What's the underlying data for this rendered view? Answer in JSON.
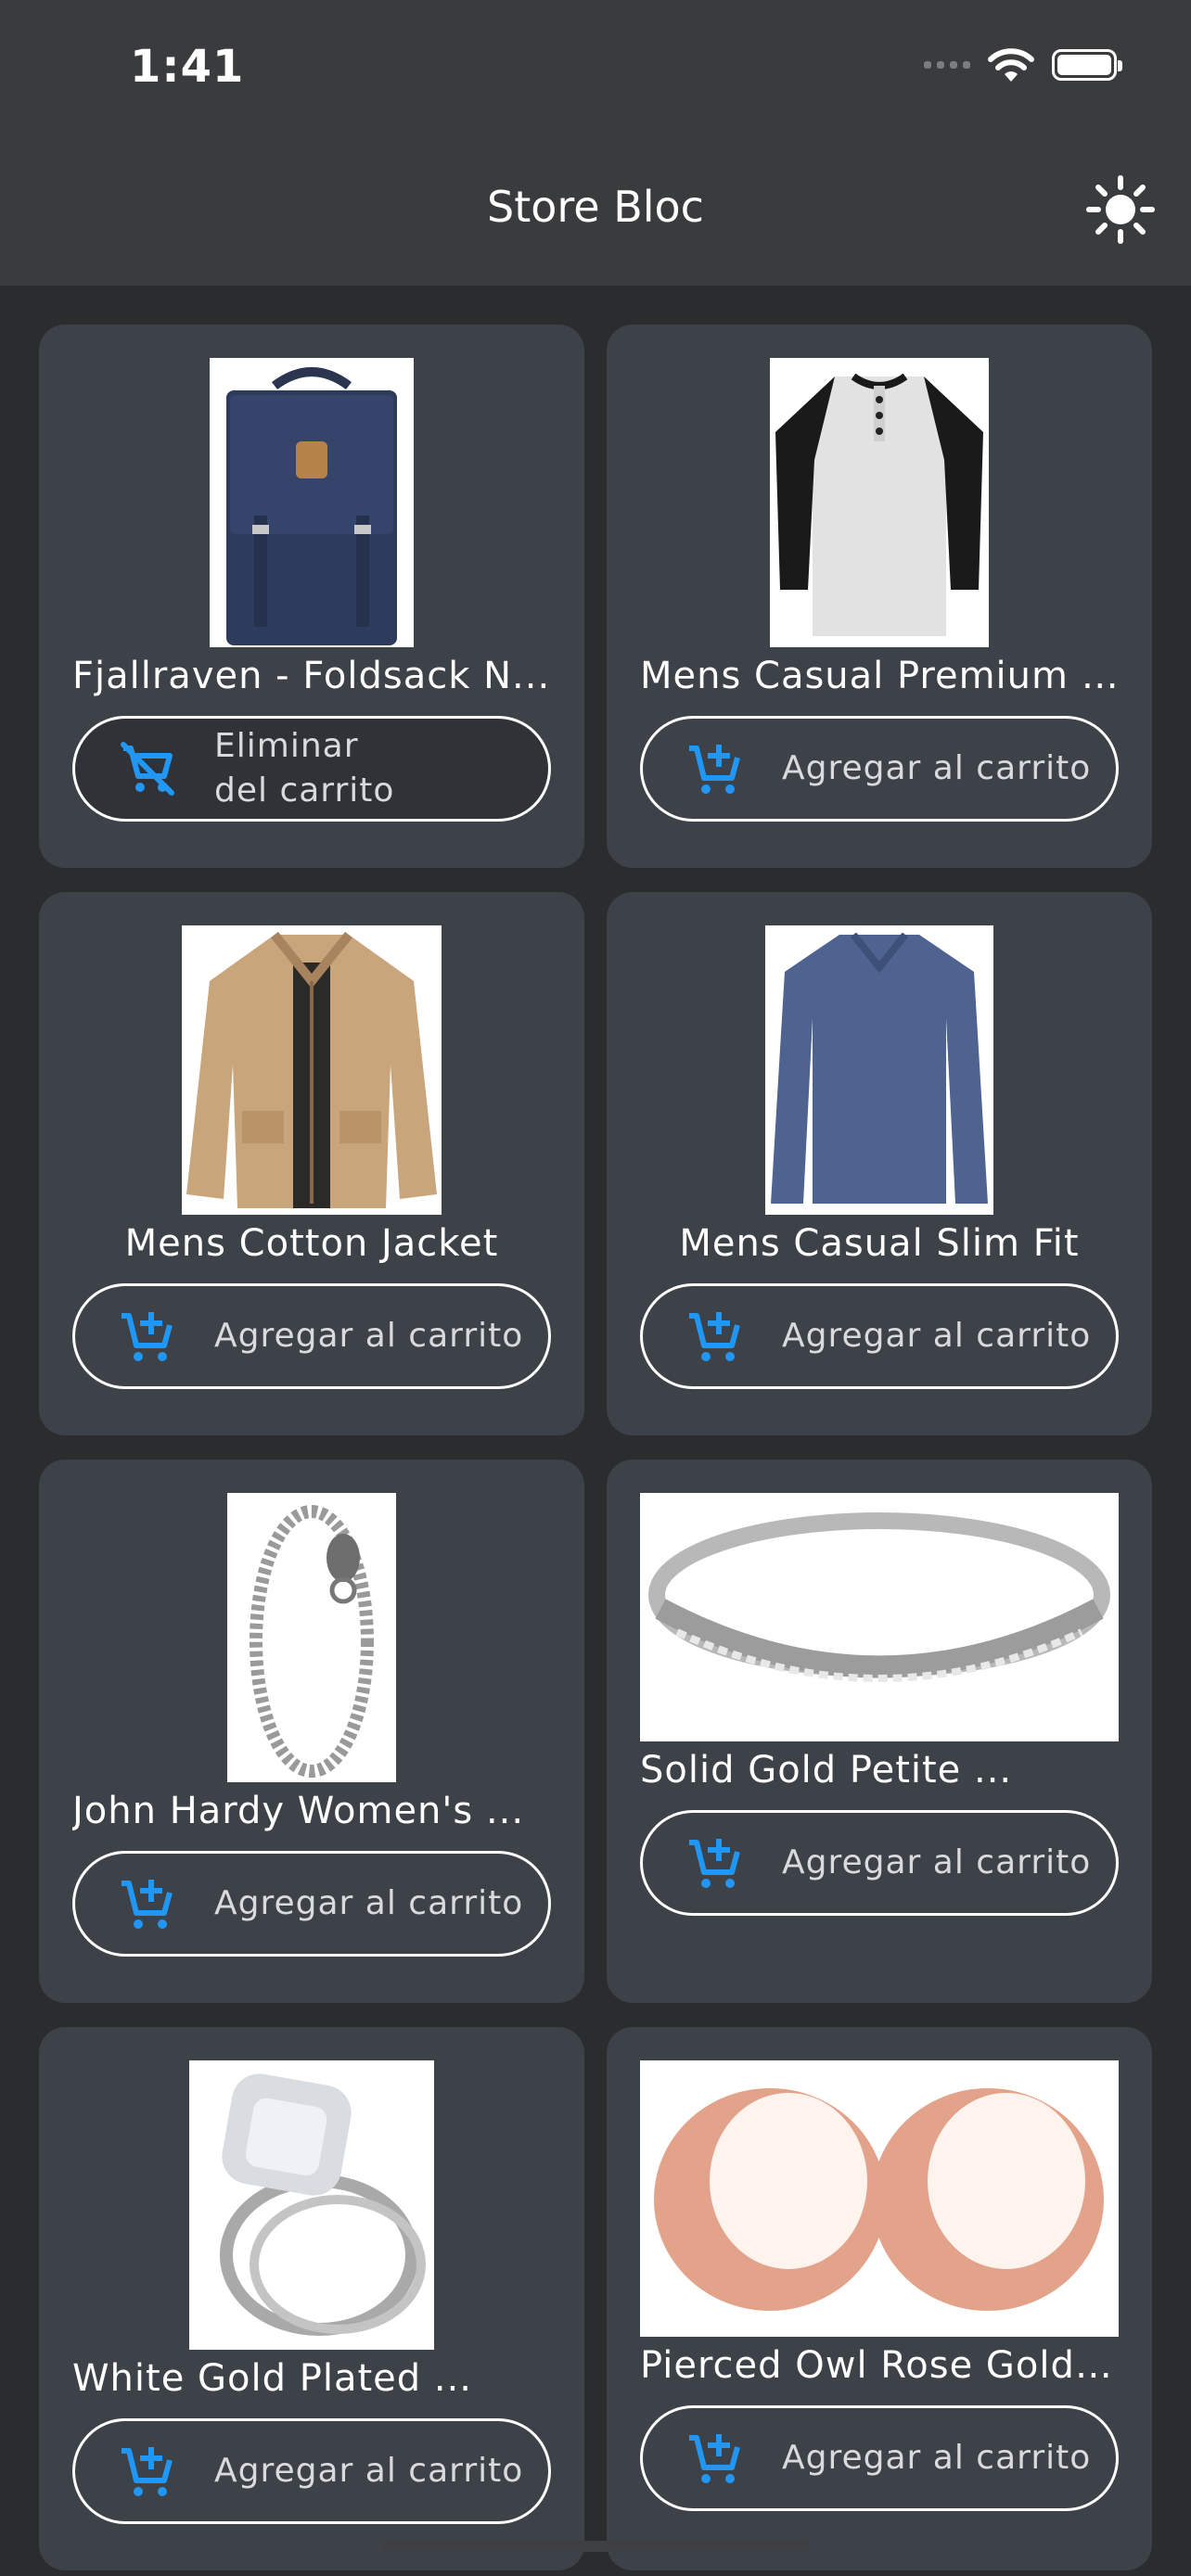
{
  "status_bar": {
    "time": "1:41"
  },
  "app_bar": {
    "title": "Store Bloc",
    "theme_icon": "sun-icon"
  },
  "colors": {
    "accent": "#2196f3",
    "card": "#3d4148",
    "appbar": "#3a3b3d",
    "background": "#2b2c2e"
  },
  "products": [
    {
      "title": "Fjallraven - Foldsack N...",
      "button": "Eliminar del carrito",
      "icon": "remove-shopping-cart-icon",
      "in_cart": true
    },
    {
      "title": "Mens Casual Premium ...",
      "button": "Agregar al carrito",
      "icon": "add-shopping-cart-icon",
      "in_cart": false
    },
    {
      "title": "Mens Cotton Jacket",
      "button": "Agregar al carrito",
      "icon": "add-shopping-cart-icon",
      "in_cart": false
    },
    {
      "title": "Mens Casual Slim Fit",
      "button": "Agregar al carrito",
      "icon": "add-shopping-cart-icon",
      "in_cart": false
    },
    {
      "title": "John Hardy Women's ...",
      "button": "Agregar al carrito",
      "icon": "add-shopping-cart-icon",
      "in_cart": false
    },
    {
      "title": "Solid Gold Petite ...",
      "button": "Agregar al carrito",
      "icon": "add-shopping-cart-icon",
      "in_cart": false
    },
    {
      "title": "White Gold Plated ...",
      "button": "Agregar al carrito",
      "icon": "add-shopping-cart-icon",
      "in_cart": false
    },
    {
      "title": "Pierced Owl Rose Gold ...",
      "button": "Agregar al carrito",
      "icon": "add-shopping-cart-icon",
      "in_cart": false
    }
  ]
}
